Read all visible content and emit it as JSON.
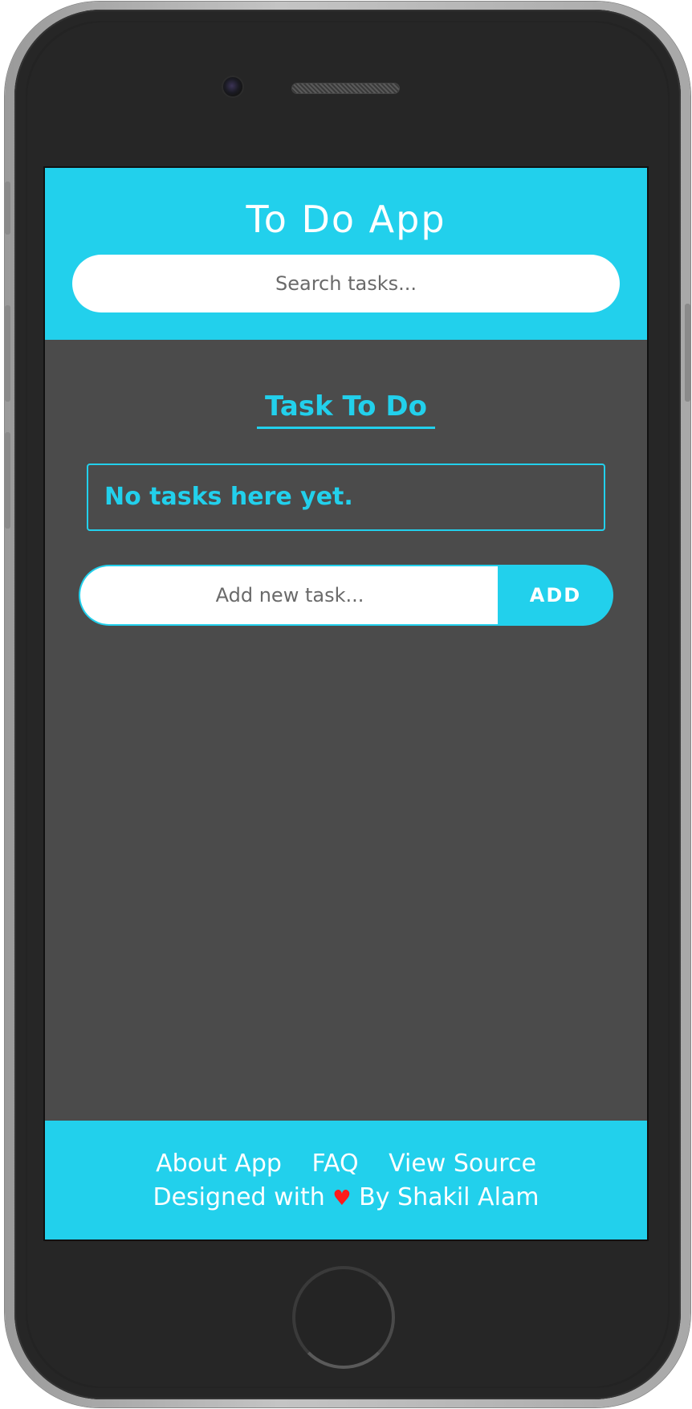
{
  "header": {
    "title": "To Do App",
    "search_placeholder": "Search tasks..."
  },
  "main": {
    "section_title": "Task To Do",
    "empty_message": "No tasks here yet.",
    "add_task_placeholder": "Add new task...",
    "add_button_label": "ADD"
  },
  "footer": {
    "links": [
      {
        "label": "About App"
      },
      {
        "label": "FAQ"
      },
      {
        "label": "View Source"
      }
    ],
    "credit_prefix": "Designed with",
    "credit_icon": "heart-icon",
    "credit_suffix": "By Shakil Alam"
  },
  "colors": {
    "accent": "#22d0ec",
    "screen_background": "#4b4b4b",
    "heart": "#ff1a1a"
  }
}
